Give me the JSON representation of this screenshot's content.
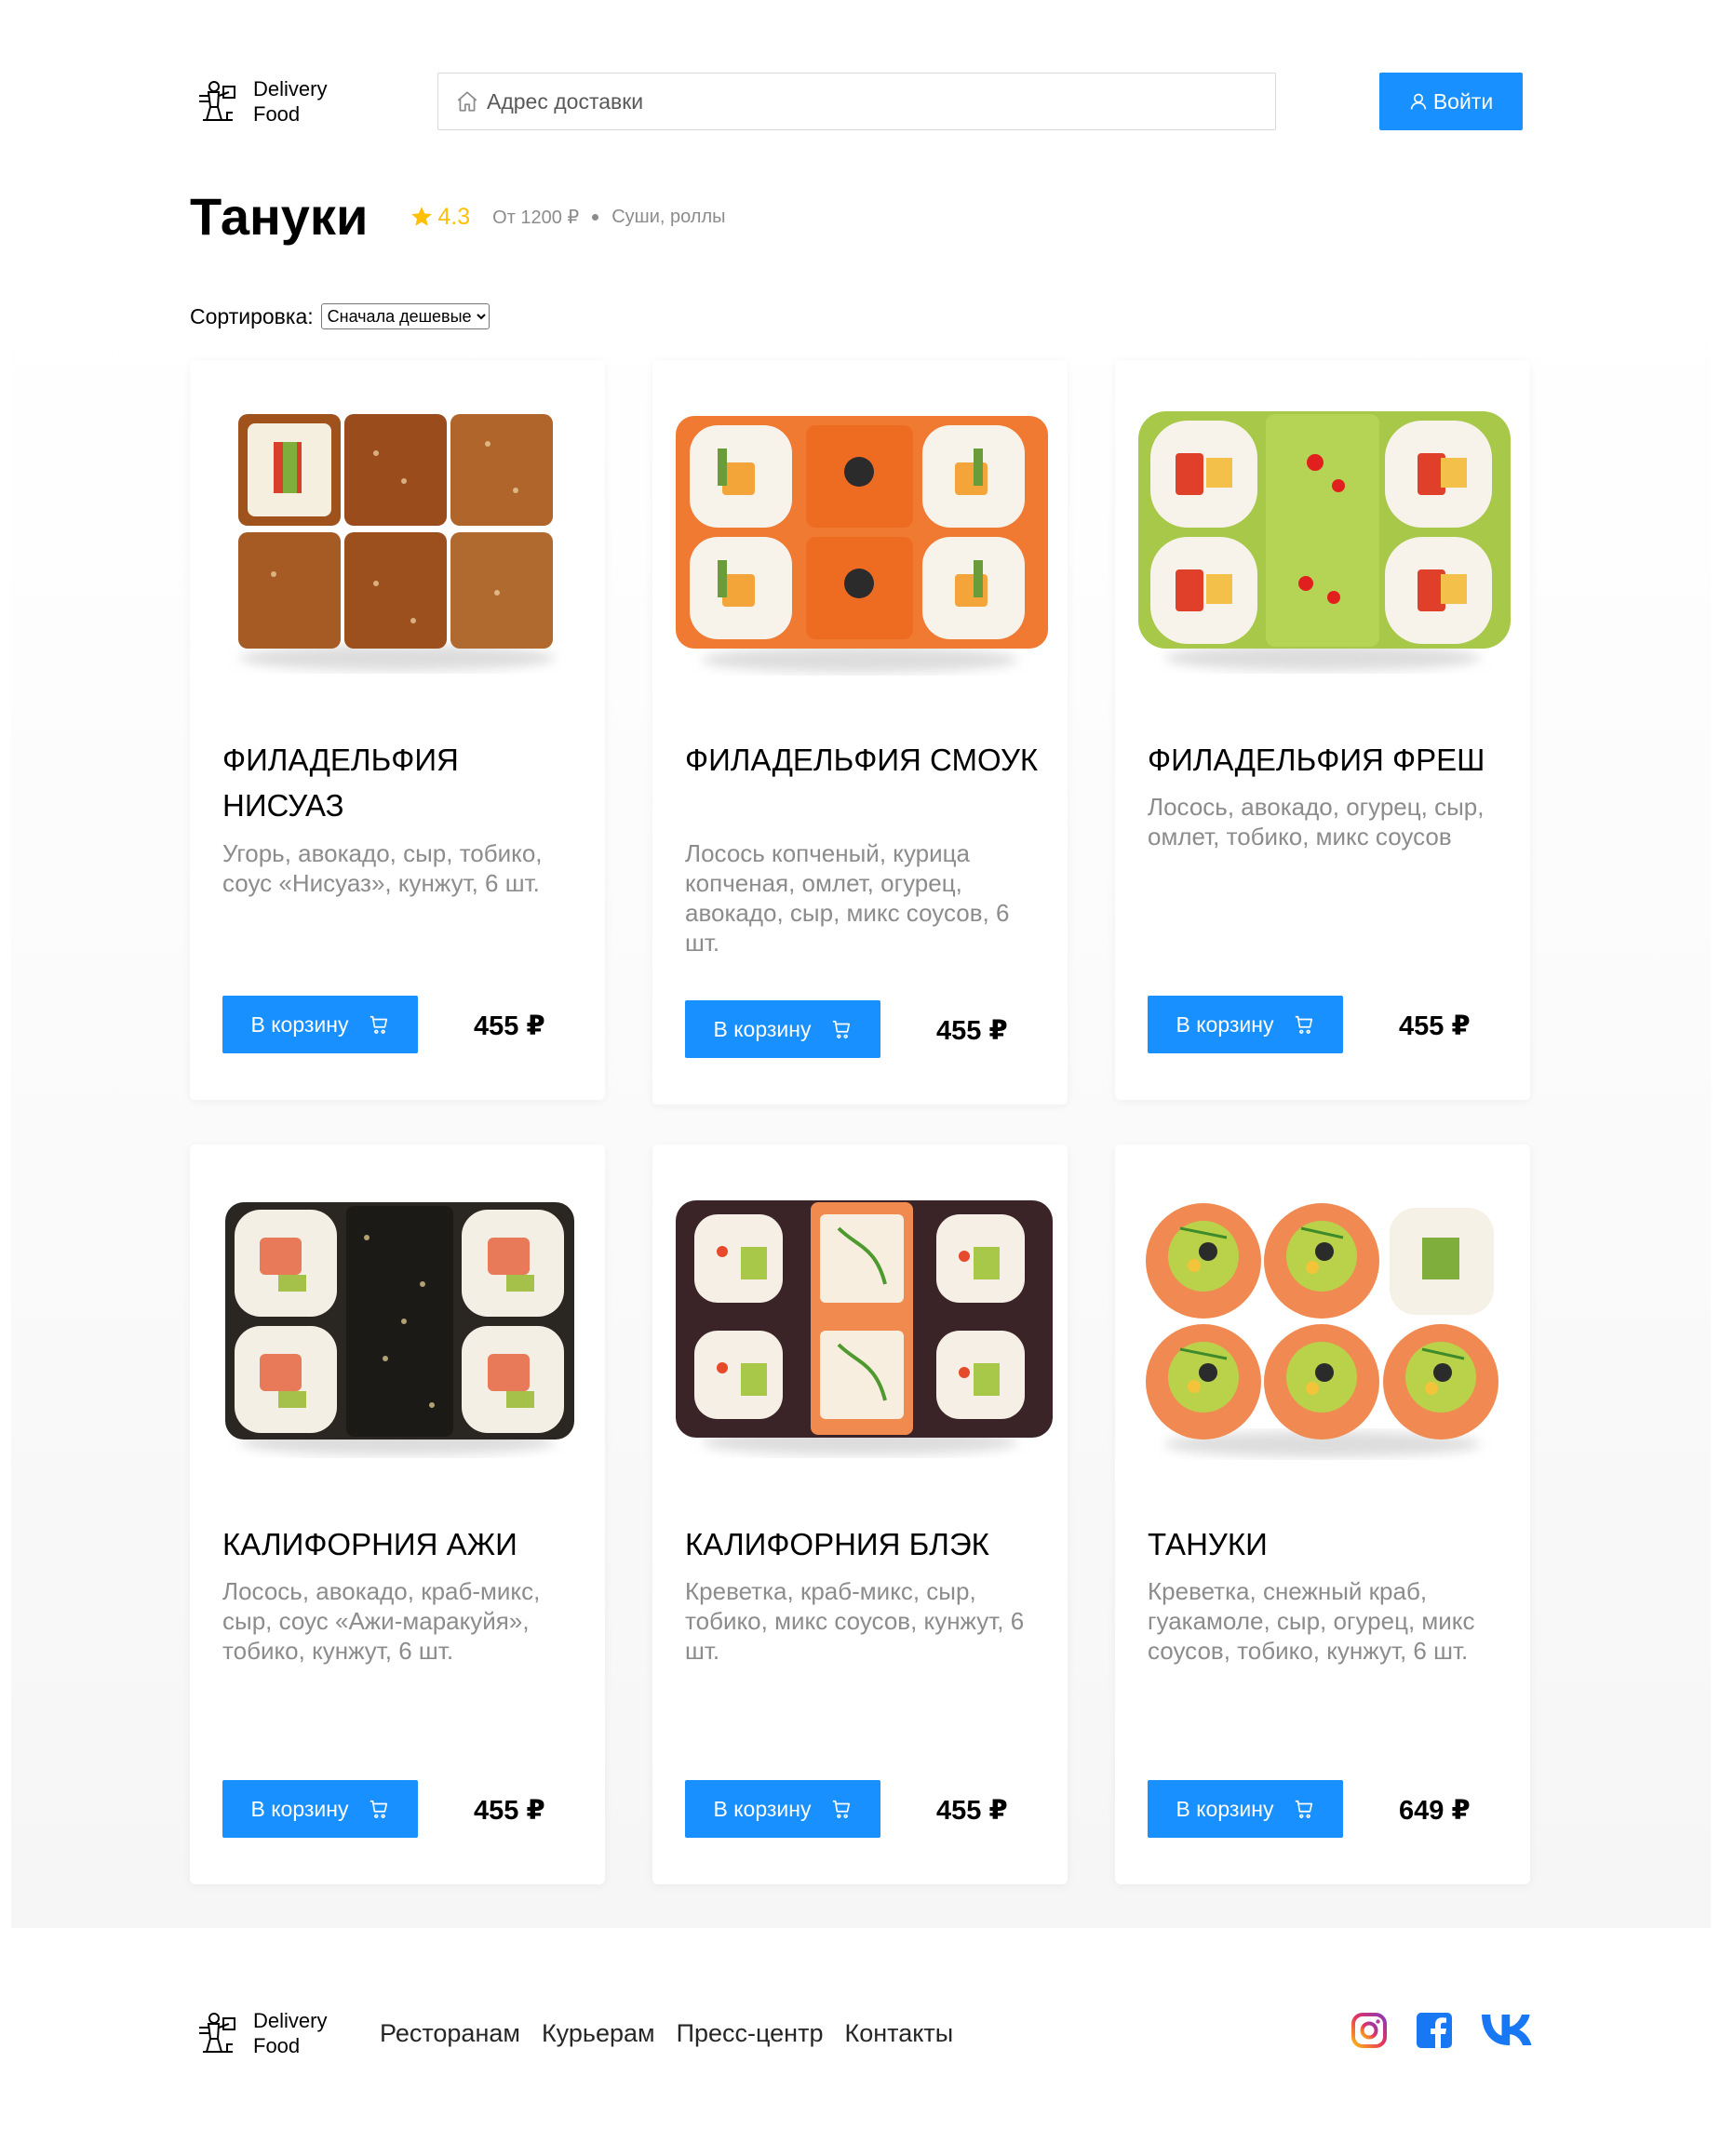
{
  "header": {
    "logo_line1": "Delivery",
    "logo_line2": "Food",
    "search_placeholder": "Адрес доставки",
    "login_label": "Войти"
  },
  "restaurant": {
    "title": "Тануки",
    "rating": "4.3",
    "price_from": "От 1200 ₽",
    "kitchen": "Суши, роллы"
  },
  "sort": {
    "label": "Сортировка:",
    "selected": "Сначала дешевые"
  },
  "cards": [
    {
      "title": "Филадельфия нисуаз",
      "desc": "Угорь, авокадо, сыр, тобико, соус «Нисуаз», кунжут, 6 шт.",
      "button": "В корзину",
      "price": "455 ₽"
    },
    {
      "title": "Филадельфия смоук",
      "desc": "Лосось копченый, курица копченая, омлет, огурец, авокадо, сыр, микс соусов, 6 шт.",
      "button": "В корзину",
      "price": "455 ₽"
    },
    {
      "title": "Филадельфия фреш",
      "desc": "Лосось, авокадо, огурец, сыр, омлет, тобико, микс соусов",
      "button": "В корзину",
      "price": "455 ₽"
    },
    {
      "title": "Калифорния ажи",
      "desc": "Лосось, авокадо, краб-микс, сыр, соус «Ажи-маракуйя», тобико, кунжут, 6 шт.",
      "button": "В корзину",
      "price": "455 ₽"
    },
    {
      "title": "Калифорния блэк",
      "desc": "Креветка, краб-микс, сыр, тобико, микс соусов, кунжут, 6 шт.",
      "button": "В корзину",
      "price": "455 ₽"
    },
    {
      "title": "Тануки",
      "desc": "Креветка, снежный краб, гуакамоле, сыр, огурец, микс соусов, тобико, кунжут, 6 шт.",
      "button": "В корзину",
      "price": "649 ₽"
    }
  ],
  "footer": {
    "logo_line1": "Delivery",
    "logo_line2": "Food",
    "nav": [
      "Ресторанам",
      "Курьерам",
      "Пресс-центр",
      "Контакты"
    ],
    "socials": [
      "instagram-icon",
      "facebook-icon",
      "vk-icon"
    ]
  },
  "colors": {
    "accent": "#1890ff",
    "star": "#ffc107",
    "muted": "#8c8c8c"
  }
}
